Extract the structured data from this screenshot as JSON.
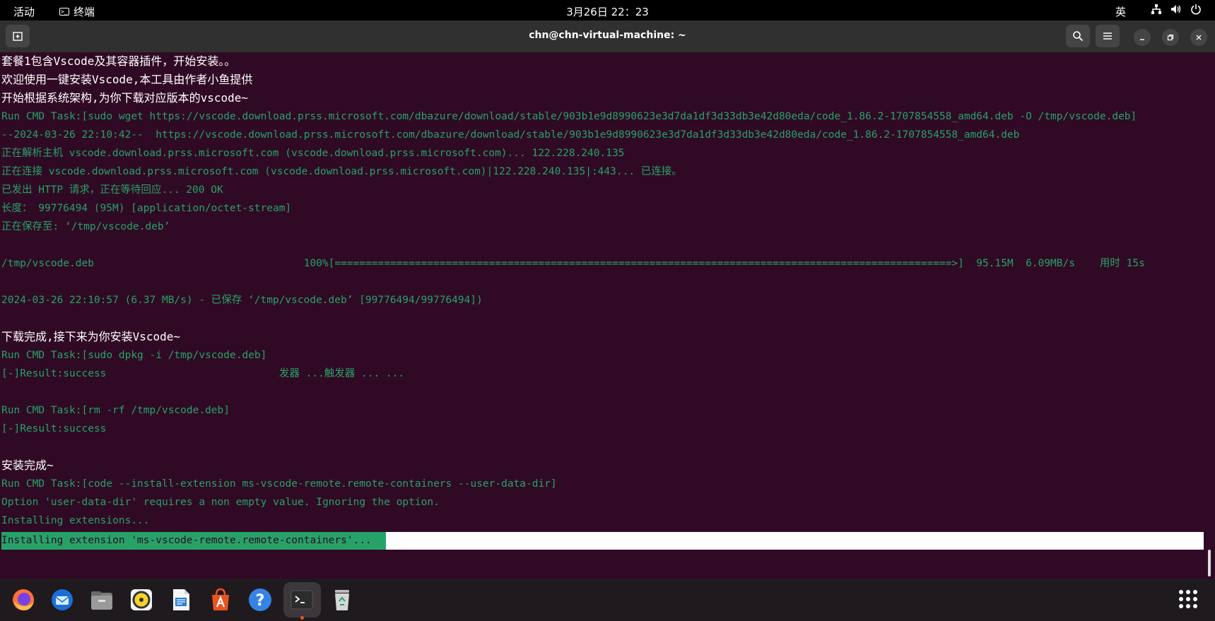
{
  "topbar": {
    "activities": "活动",
    "app_name": "终端",
    "clock": "3月26日  22：23",
    "ime": "英"
  },
  "window": {
    "title": "chn@chn-virtual-machine: ~"
  },
  "terminal": {
    "lines": [
      {
        "text": "套餐1包含Vscode及其容器插件，开始安装。。",
        "color": "white"
      },
      {
        "text": "欢迎使用一键安装Vscode,本工具由作者小鱼提供",
        "color": "white"
      },
      {
        "text": "开始根据系统架构,为你下载对应版本的vscode~",
        "color": "white"
      },
      {
        "text": "Run CMD Task:[sudo wget https://vscode.download.prss.microsoft.com/dbazure/download/stable/903b1e9d8990623e3d7da1df3d33db3e42d80eda/code_1.86.2-1707854558_amd64.deb -O /tmp/vscode.deb]",
        "color": "green"
      },
      {
        "text": "--2024-03-26 22:10:42--  https://vscode.download.prss.microsoft.com/dbazure/download/stable/903b1e9d8990623e3d7da1df3d33db3e42d80eda/code_1.86.2-1707854558_amd64.deb",
        "color": "green"
      },
      {
        "text": "正在解析主机 vscode.download.prss.microsoft.com (vscode.download.prss.microsoft.com)... 122.228.240.135",
        "color": "green"
      },
      {
        "text": "正在连接 vscode.download.prss.microsoft.com (vscode.download.prss.microsoft.com)|122.228.240.135|:443... 已连接。",
        "color": "green"
      },
      {
        "text": "已发出 HTTP 请求，正在等待回应... 200 OK",
        "color": "green"
      },
      {
        "text": "长度： 99776494 (95M) [application/octet-stream]",
        "color": "green"
      },
      {
        "text": "正在保存至: ‘/tmp/vscode.deb’",
        "color": "green"
      },
      {
        "text": "",
        "color": "green"
      },
      {
        "text": "/tmp/vscode.deb                                  100%[====================================================================================================>]  95.15M  6.09MB/s    用时 15s",
        "color": "green"
      },
      {
        "text": "",
        "color": "green"
      },
      {
        "text": "2024-03-26 22:10:57 (6.37 MB/s) - 已保存 ‘/tmp/vscode.deb’ [99776494/99776494])",
        "color": "green"
      },
      {
        "text": "",
        "color": "green"
      },
      {
        "text": "下载完成,接下来为你安装Vscode~",
        "color": "white"
      },
      {
        "text": "Run CMD Task:[sudo dpkg -i /tmp/vscode.deb]",
        "color": "green"
      },
      {
        "text": "[-]Result:success                            发器 ...触发器 ... ...",
        "color": "green"
      },
      {
        "text": "",
        "color": "green"
      },
      {
        "text": "Run CMD Task:[rm -rf /tmp/vscode.deb]",
        "color": "green"
      },
      {
        "text": "[-]Result:success",
        "color": "green"
      },
      {
        "text": "",
        "color": "green"
      },
      {
        "text": "安装完成~",
        "color": "white"
      },
      {
        "text": "Run CMD Task:[code --install-extension ms-vscode-remote.remote-containers --user-data-dir]",
        "color": "green"
      },
      {
        "text": "Option 'user-data-dir' requires a non empty value. Ignoring the option.",
        "color": "green"
      },
      {
        "text": "Installing extensions...",
        "color": "green"
      }
    ],
    "progress_text": "Installing extension 'ms-vscode-remote.remote-containers'...",
    "progress_fraction": 0.32
  },
  "dock": {
    "apps": [
      {
        "name": "firefox-icon",
        "color": "#ff7139"
      },
      {
        "name": "thunderbird-icon",
        "color": "#1a6fd6"
      },
      {
        "name": "files-icon",
        "color": "#8a8a8a"
      },
      {
        "name": "rhythmbox-icon",
        "color": "#f6d32d"
      },
      {
        "name": "writer-icon",
        "color": "#2a7fd4"
      },
      {
        "name": "software-icon",
        "color": "#e95420"
      },
      {
        "name": "help-icon",
        "color": "#3584e4"
      },
      {
        "name": "terminal-icon",
        "color": "#2c2c2c"
      },
      {
        "name": "trash-icon",
        "color": "#9a9a9a"
      }
    ]
  }
}
